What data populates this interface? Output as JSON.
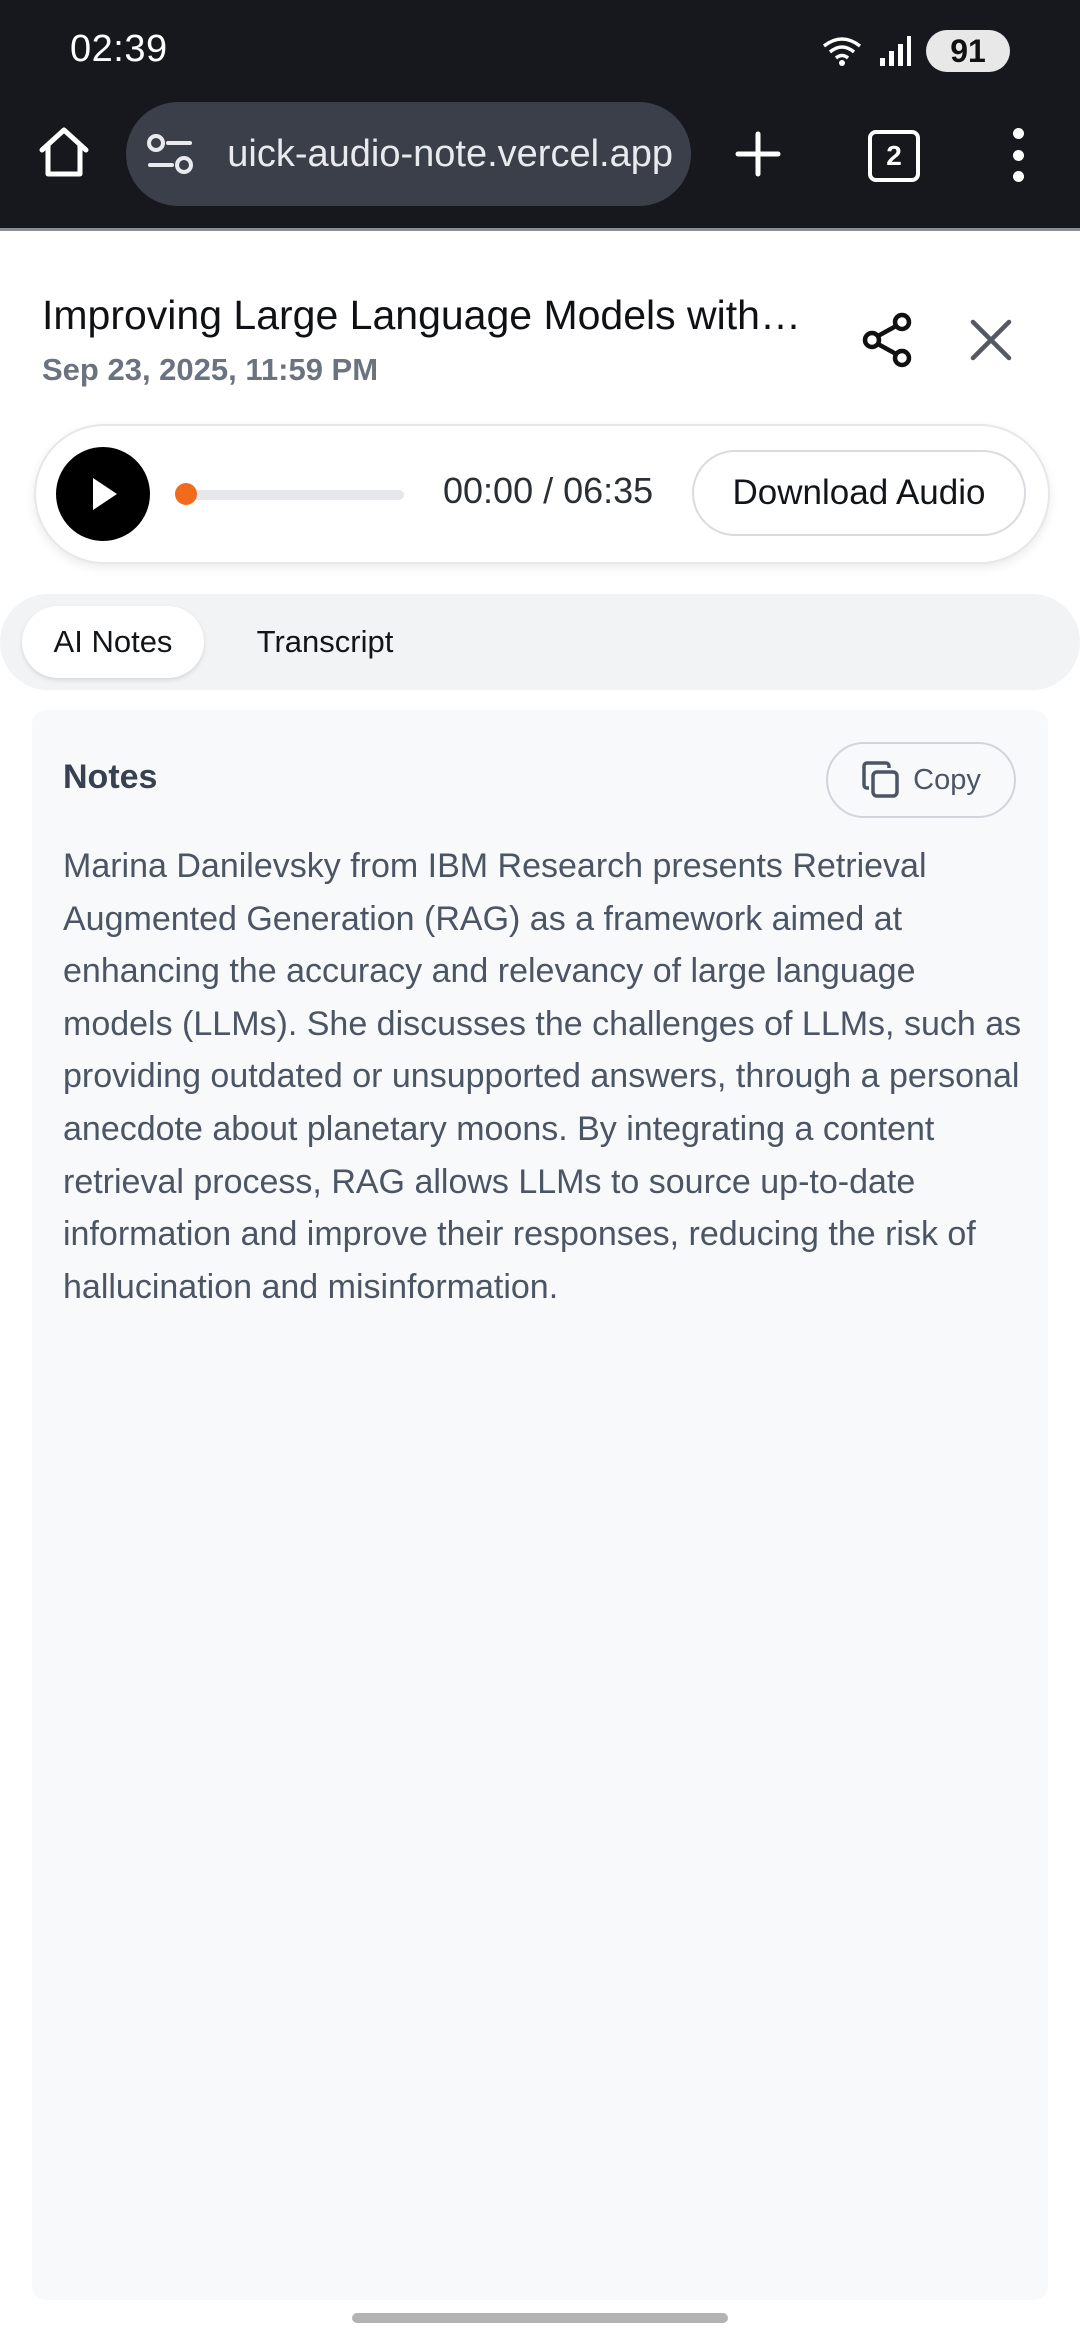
{
  "status_bar": {
    "time": "02:39",
    "battery": "91",
    "wifi_icon": "wifi-icon",
    "signal_icon": "signal-icon"
  },
  "browser": {
    "url": "uick-audio-note.vercel.app",
    "tab_count": "2",
    "home_icon": "home-icon",
    "site_settings_icon": "site-settings-icon",
    "new_tab_icon": "plus-icon",
    "menu_icon": "more-vert-icon"
  },
  "recording": {
    "title": "Improving Large Language Models with…",
    "date": "Sep 23, 2025, 11:59 PM"
  },
  "player": {
    "time_display": "00:00 / 06:35",
    "progress": 0,
    "download_label": "Download Audio",
    "accent_color": "#f26b1d"
  },
  "tabs": [
    {
      "label": "AI Notes",
      "active": true
    },
    {
      "label": "Transcript",
      "active": false
    }
  ],
  "notes": {
    "heading": "Notes",
    "copy_label": "Copy",
    "body": "Marina Danilevsky from IBM Research presents Retrieval Augmented Generation (RAG) as a framework aimed at enhancing the accuracy and relevancy of large language models (LLMs). She discusses the challenges of LLMs, such as providing outdated or unsupported answers, through a personal anecdote about planetary moons. By integrating a content retrieval process, RAG allows LLMs to source up-to-date information and improve their responses, reducing the risk of hallucination and misinformation."
  }
}
